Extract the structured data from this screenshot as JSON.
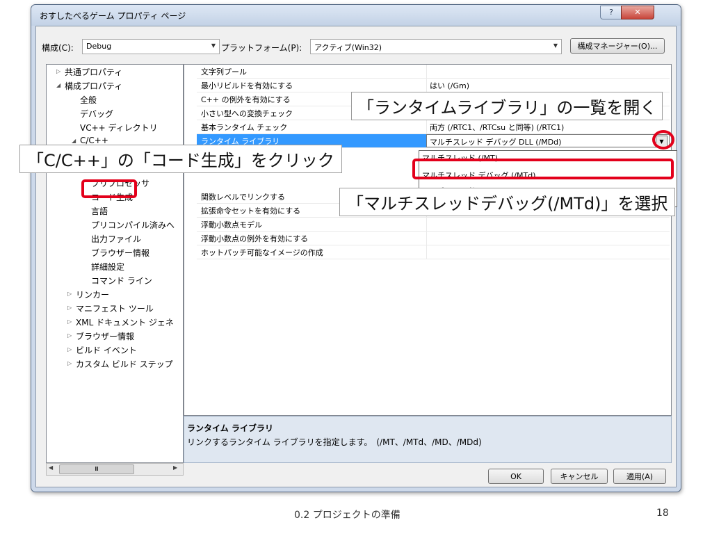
{
  "dialog": {
    "title": "おすしたべるゲーム プロパティ ページ",
    "help_label": "?",
    "close_label": "✕"
  },
  "toolbar": {
    "config_label": "構成(C):",
    "config_value": "Debug",
    "platform_label": "プラットフォーム(P):",
    "platform_value": "アクティブ(Win32)",
    "config_manager_label": "構成マネージャー(O)..."
  },
  "tree": {
    "common_props": "共通プロパティ",
    "config_props": "構成プロパティ",
    "general": "全般",
    "debugging": "デバッグ",
    "vc_dirs": "VC++ ディレクトリ",
    "c_cpp": "C/C++",
    "preprocessor": "プリプロセッサ",
    "code_generation": "コード生成",
    "language": "言語",
    "precompiled_headers": "プリコンパイル済みへ",
    "output_files": "出力ファイル",
    "browse_info": "ブラウザー情報",
    "advanced": "詳細設定",
    "command_line": "コマンド ライン",
    "linker": "リンカー",
    "manifest_tool": "マニフェスト ツール",
    "xml_doc": "XML ドキュメント ジェネ",
    "browse_info2": "ブラウザー情報",
    "build_events": "ビルド イベント",
    "custom_build": "カスタム ビルド ステップ",
    "scroll_thumb": "Ⅲ"
  },
  "grid": {
    "string_pooling": "文字列プール",
    "minimal_rebuild": "最小リビルドを有効にする",
    "minimal_rebuild_value": "はい (/Gm)",
    "cpp_exceptions": "C++ の例外を有効にする",
    "smaller_type_check": "小さい型への変換チェック",
    "basic_runtime_checks": "基本ランタイム チェック",
    "basic_runtime_checks_value": "両方 (/RTC1、/RTCsu と同等) (/RTC1)",
    "runtime_library": "ランタイム ライブラリ",
    "runtime_library_value": "マルチスレッド デバッグ DLL (/MDd)",
    "function_level_linking": "関数レベルでリンクする",
    "enhanced_instruction_set": "拡張命令セットを有効にする",
    "floating_point_model": "浮動小数点モデル",
    "floating_point_exceptions": "浮動小数点の例外を有効にする",
    "hotpatchable_image": "ホットパッチ可能なイメージの作成"
  },
  "dropdown": {
    "option_mt": "マルチスレッド (/MT)",
    "option_mtd": "マルチスレッド デバッグ (/MTd)",
    "option_md": "マルチスレッド DLL (/MD)"
  },
  "description": {
    "title": "ランタイム ライブラリ",
    "text": "リンクするランタイム ライブラリを指定します。　(/MT、/MTd、/MD、/MDd)"
  },
  "buttons": {
    "ok": "OK",
    "cancel": "キャンセル",
    "apply": "適用(A)"
  },
  "callouts": {
    "open_list": "「ランタイムライブラリ」の一覧を開く",
    "click_codegen": "「C/C++」の「コード生成」をクリック",
    "select_mtd": "「マルチスレッドデバッグ(/MTd)」を選択"
  },
  "footer": {
    "section": "0.2 プロジェクトの準備",
    "page": "18"
  },
  "colors": {
    "highlight_red": "#e3001b",
    "selection_blue": "#3399ff"
  }
}
